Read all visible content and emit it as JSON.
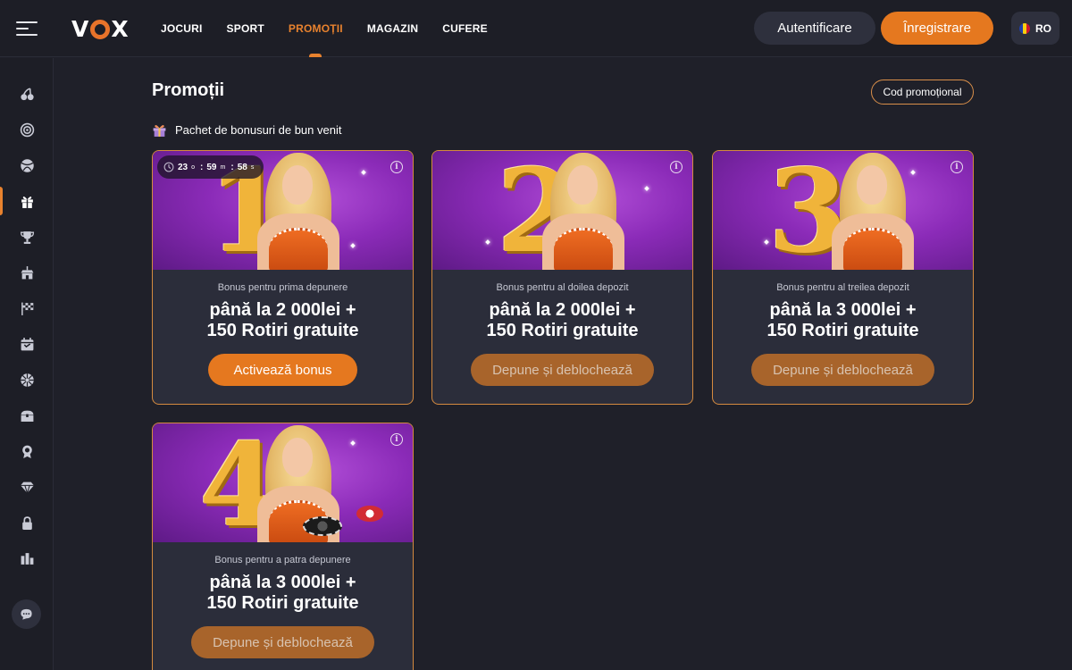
{
  "header": {
    "logo": "VOX",
    "nav": [
      {
        "label": "JOCURI",
        "active": false
      },
      {
        "label": "SPORT",
        "active": false
      },
      {
        "label": "PROMOȚII",
        "active": true
      },
      {
        "label": "MAGAZIN",
        "active": false
      },
      {
        "label": "CUFERE",
        "active": false
      }
    ],
    "login_label": "Autentificare",
    "register_label": "Înregistrare",
    "language": "RO"
  },
  "sidebar": {
    "items": [
      {
        "icon": "cherries-icon",
        "active": false
      },
      {
        "icon": "target-icon",
        "active": false
      },
      {
        "icon": "ball-icon",
        "active": false
      },
      {
        "icon": "gift-icon",
        "active": true
      },
      {
        "icon": "trophy-icon",
        "active": false
      },
      {
        "icon": "store-icon",
        "active": false
      },
      {
        "icon": "flag-icon",
        "active": false
      },
      {
        "icon": "calendar-icon",
        "active": false
      },
      {
        "icon": "wheel-icon",
        "active": false
      },
      {
        "icon": "chest-icon",
        "active": false
      },
      {
        "icon": "medal-icon",
        "active": false
      },
      {
        "icon": "diamond-icon",
        "active": false
      },
      {
        "icon": "lock-icon",
        "active": false
      },
      {
        "icon": "leaderboard-icon",
        "active": false
      }
    ],
    "chat_icon": "chat-icon"
  },
  "page": {
    "title": "Promoții",
    "promo_code_label": "Cod promoțional",
    "section_title": "Pachet de bonusuri de bun venit"
  },
  "cards": [
    {
      "number": "1",
      "subtitle": "Bonus pentru prima depunere",
      "amount_line1": "până la 2 000lei +",
      "amount_line2": "150 Rotiri gratuite",
      "button": "Activează bonus",
      "button_state": "active",
      "timer": {
        "hours": "23",
        "hours_unit": "o",
        "minutes": "59",
        "minutes_unit": "m",
        "seconds": "58",
        "seconds_unit": "s",
        "sep": ":"
      }
    },
    {
      "number": "2",
      "subtitle": "Bonus pentru al doilea depozit",
      "amount_line1": "până la 2 000lei +",
      "amount_line2": "150 Rotiri gratuite",
      "button": "Depune și deblochează",
      "button_state": "locked"
    },
    {
      "number": "3",
      "subtitle": "Bonus pentru al treilea depozit",
      "amount_line1": "până la 3 000lei +",
      "amount_line2": "150 Rotiri gratuite",
      "button": "Depune și deblochează",
      "button_state": "locked"
    },
    {
      "number": "4",
      "subtitle": "Bonus pentru a patra depunere",
      "amount_line1": "până la 3 000lei +",
      "amount_line2": "150 Rotiri gratuite",
      "button": "Depune și deblochează",
      "button_state": "locked"
    }
  ],
  "info_glyph": "i",
  "colors": {
    "accent": "#e5781f",
    "background": "#1f2029",
    "card": "#2b2d3a",
    "card_border": "#d48a3f",
    "locked_button": "#a8642b"
  }
}
